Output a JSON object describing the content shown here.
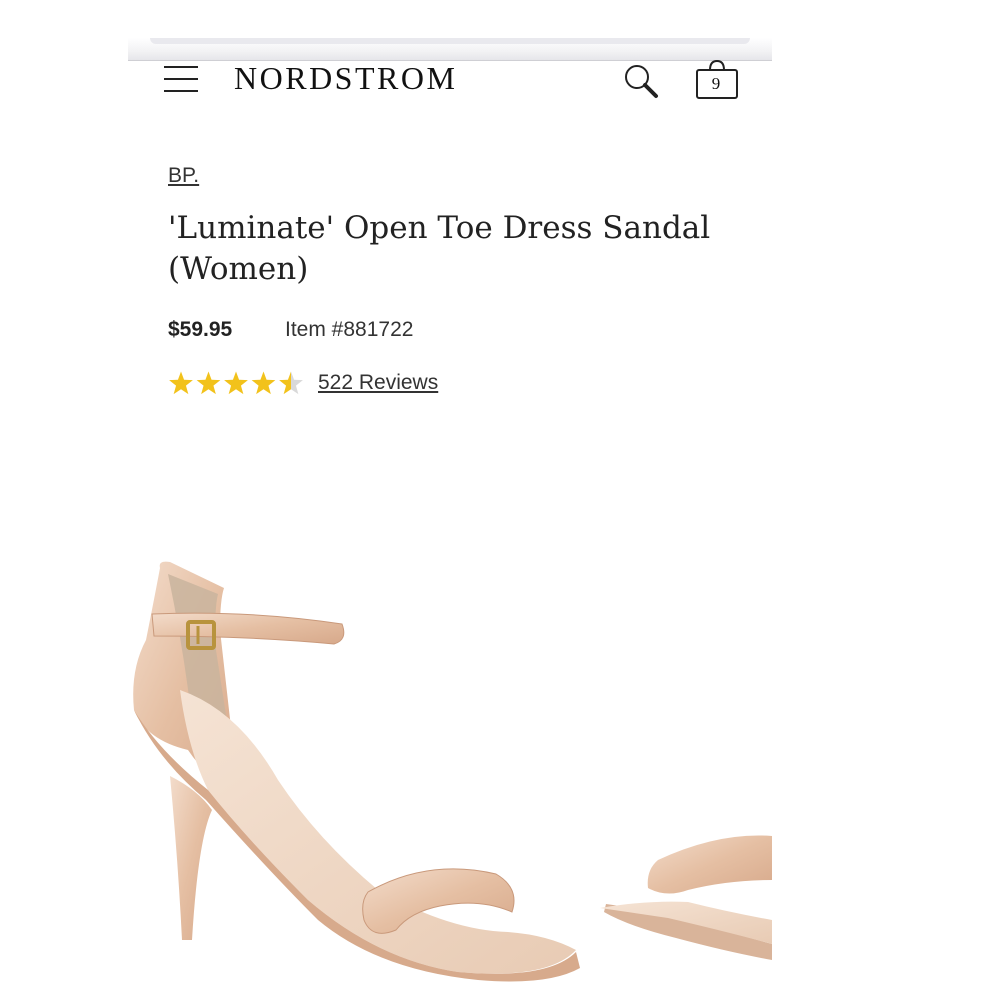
{
  "header": {
    "brand": "NORDSTROM",
    "menu_icon": "hamburger-menu-icon",
    "search_icon": "search-icon",
    "bag_icon": "shopping-bag-icon",
    "bag_count": "9"
  },
  "product": {
    "brand": "BP.",
    "title": "'Luminate' Open Toe Dress Sandal (Women)",
    "price": "$59.95",
    "item_number": "Item #881722",
    "rating": {
      "value": 4.5,
      "max": 5,
      "reviews_label": "522 Reviews"
    },
    "image_alt_icon": "sandal-product-image"
  },
  "colors": {
    "star_filled": "#f2c21b",
    "star_empty": "#d9d9d9",
    "text": "#222222",
    "patent_nude": "#e8c4a8"
  }
}
